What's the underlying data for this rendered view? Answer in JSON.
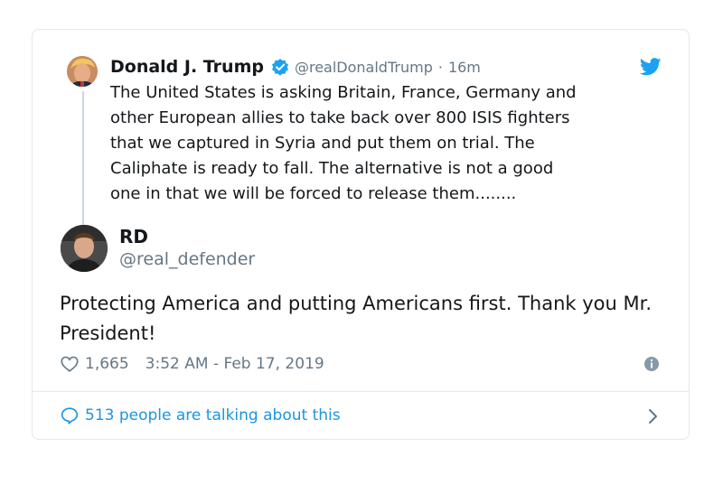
{
  "quoted_tweet": {
    "name": "Donald J. Trump",
    "handle": "@realDonaldTrump",
    "separator": "·",
    "time": "16m",
    "text": "The United States is asking Britain, France, Germany and\nother European allies to take back over 800 ISIS fighters\nthat we captured in Syria and put them on trial. The\nCaliphate is ready to fall. The alternative is not a good\none in that we will be forced to release them........"
  },
  "tweet": {
    "name": "RD",
    "handle": "@real_defender",
    "text": "Protecting America and putting Americans first. Thank you Mr. President!",
    "likes": "1,665",
    "timestamp": "3:52 AM - Feb 17, 2019"
  },
  "footer": {
    "talking_label": "513 people are talking about this"
  },
  "colors": {
    "accent": "#1da1f2",
    "link": "#1b95e0",
    "muted": "#657786",
    "border": "#e1e8ed"
  },
  "icons": [
    "verified-icon",
    "twitter-bird-icon",
    "heart-icon",
    "info-icon",
    "speech-bubble-icon",
    "chevron-right-icon"
  ]
}
